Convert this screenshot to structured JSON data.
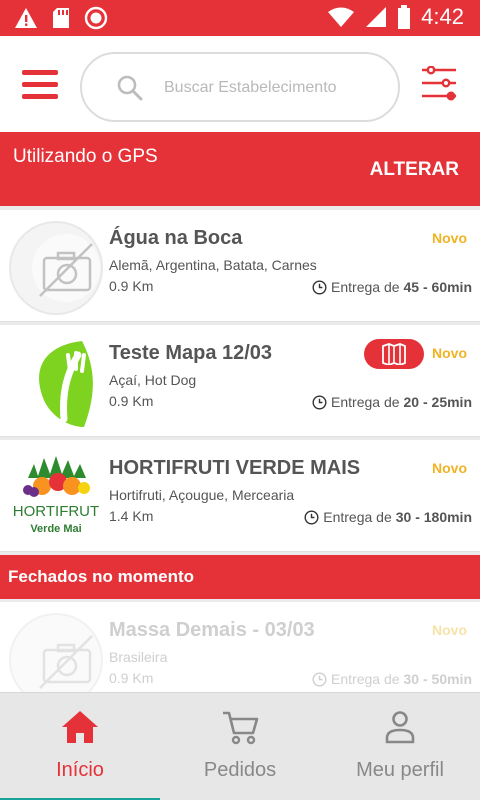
{
  "status_bar": {
    "time": "4:42",
    "icons": [
      "warning-icon",
      "sd-card-icon",
      "record-icon",
      "wifi-icon",
      "signal-icon",
      "battery-icon"
    ]
  },
  "header": {
    "search_placeholder": "Buscar Estabelecimento"
  },
  "location": {
    "text": "Utilizando o GPS",
    "change_label": "ALTERAR"
  },
  "stores": [
    {
      "name": "Água na Boca",
      "tag": "Novo",
      "categories": "Alemã, Argentina, Batata, Carnes",
      "distance": "0.9 Km",
      "delivery_prefix": "Entrega de",
      "delivery_time": "45 - 60min"
    },
    {
      "name": "Teste Mapa 12/03",
      "tag": "Novo",
      "categories": "Açaí, Hot Dog",
      "distance": "0.9 Km",
      "delivery_prefix": "Entrega de",
      "delivery_time": "20 - 25min"
    },
    {
      "name": "HORTIFRUTI VERDE MAIS",
      "tag": "Novo",
      "categories": "Hortifruti, Açougue, Mercearia",
      "distance": "1.4 Km",
      "delivery_prefix": "Entrega de",
      "delivery_time": "30 - 180min",
      "logo_text_1": "HORTIFRUT",
      "logo_text_2": "Verde Mai"
    }
  ],
  "closed_section": {
    "title": "Fechados no momento"
  },
  "closed_stores": [
    {
      "name": "Massa Demais - 03/03",
      "tag": "Novo",
      "categories": "Brasileira",
      "distance": "0.9 Km",
      "delivery_prefix": "Entrega de",
      "delivery_time": "30 - 50min"
    }
  ],
  "bottom_nav": {
    "items": [
      {
        "label": "Início",
        "icon": "home-icon",
        "active": true
      },
      {
        "label": "Pedidos",
        "icon": "cart-icon",
        "active": false
      },
      {
        "label": "Meu perfil",
        "icon": "user-icon",
        "active": false
      }
    ]
  },
  "colors": {
    "brand_red": "#e53238",
    "new_tag": "#f0b323",
    "active_underline": "#1aa39b"
  }
}
